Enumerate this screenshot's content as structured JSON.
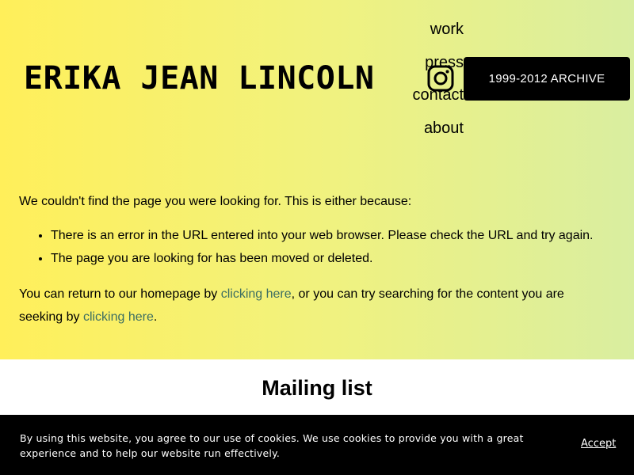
{
  "header": {
    "title": "ERIKA JEAN LINCOLN",
    "nav": [
      "work",
      "press",
      "contact",
      "about"
    ],
    "archive_button": "1999-2012 ARCHIVE",
    "social_icon": "instagram-icon"
  },
  "error": {
    "intro": "We couldn't find the page you were looking for. This is either because:",
    "reasons": [
      "There is an error in the URL entered into your web browser. Please check the URL and try again.",
      "The page you are looking for has been moved or deleted."
    ],
    "return_text_1": "You can return to our homepage by ",
    "link_1": "clicking here",
    "return_text_2": ", or you can try searching for the content you are seeking by ",
    "link_2": "clicking here",
    "return_text_3": "."
  },
  "mailing": {
    "title": "Mailing list"
  },
  "cookie": {
    "text": "By using this website, you agree to our use of cookies. We use cookies to provide you with a great experience and to help our website run effectively.",
    "accept": "Accept"
  },
  "colors": {
    "gradient_start": "#ffef5a",
    "gradient_end": "#d9eea0",
    "link": "#3c6e62"
  }
}
